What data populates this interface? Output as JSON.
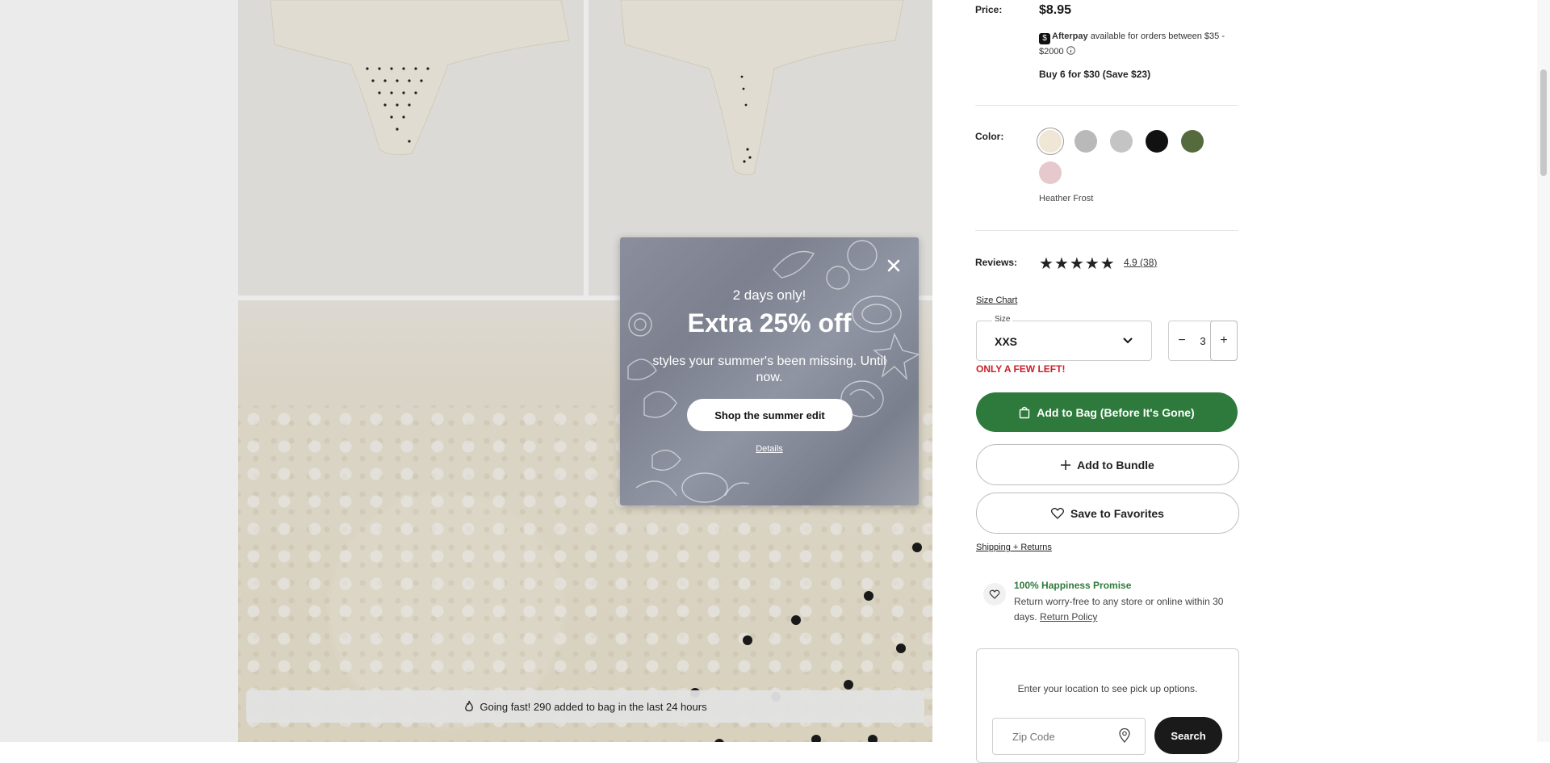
{
  "toast": {
    "text": "Going fast! 290 added to bag in the last 24 hours"
  },
  "modal": {
    "subhead": "2 days only!",
    "headline": "Extra 25% off",
    "body": "styles your summer's been missing. Until now.",
    "cta": "Shop the summer edit",
    "details": "Details"
  },
  "product": {
    "price_label": "Price:",
    "price": "$8.95",
    "afterpay_brand": "Afterpay",
    "afterpay_text": "available for orders between $35 - $2000",
    "promo": "Buy 6 for $30 (Save $23)",
    "color_label": "Color:",
    "color_selected": "Heather Frost",
    "swatches": [
      {
        "name": "heather-frost",
        "color": "#efe6d6"
      },
      {
        "name": "heather-grey",
        "color": "#b9b9b9"
      },
      {
        "name": "grey-dot",
        "color": "#c4c4c4"
      },
      {
        "name": "black",
        "color": "#111111"
      },
      {
        "name": "olive",
        "color": "#556b3e"
      },
      {
        "name": "blush",
        "color": "#e6c9cc"
      }
    ],
    "reviews_label": "Reviews:",
    "rating": "4.9",
    "review_count": "(38)",
    "size_chart": "Size Chart",
    "size_label": "Size",
    "size_value": "XXS",
    "qty_minus": "−",
    "qty_value": "3",
    "qty_plus": "+",
    "stock_warning": "ONLY A FEW LEFT!",
    "add_to_bag": "Add to Bag (Before It's Gone)",
    "add_to_bundle": "Add to Bundle",
    "save_favorites": "Save to Favorites",
    "shipping_returns": "Shipping + Returns",
    "happiness_title": "100% Happiness Promise",
    "happiness_desc": "Return worry-free to any store or online within 30 days.",
    "return_policy": "Return Policy",
    "pickup_msg": "Enter your location to see pick up options.",
    "zip_placeholder": "Zip Code",
    "search_button": "Search"
  },
  "colors": {
    "accent_green": "#2e7a3c",
    "warning_red": "#c8202a"
  }
}
